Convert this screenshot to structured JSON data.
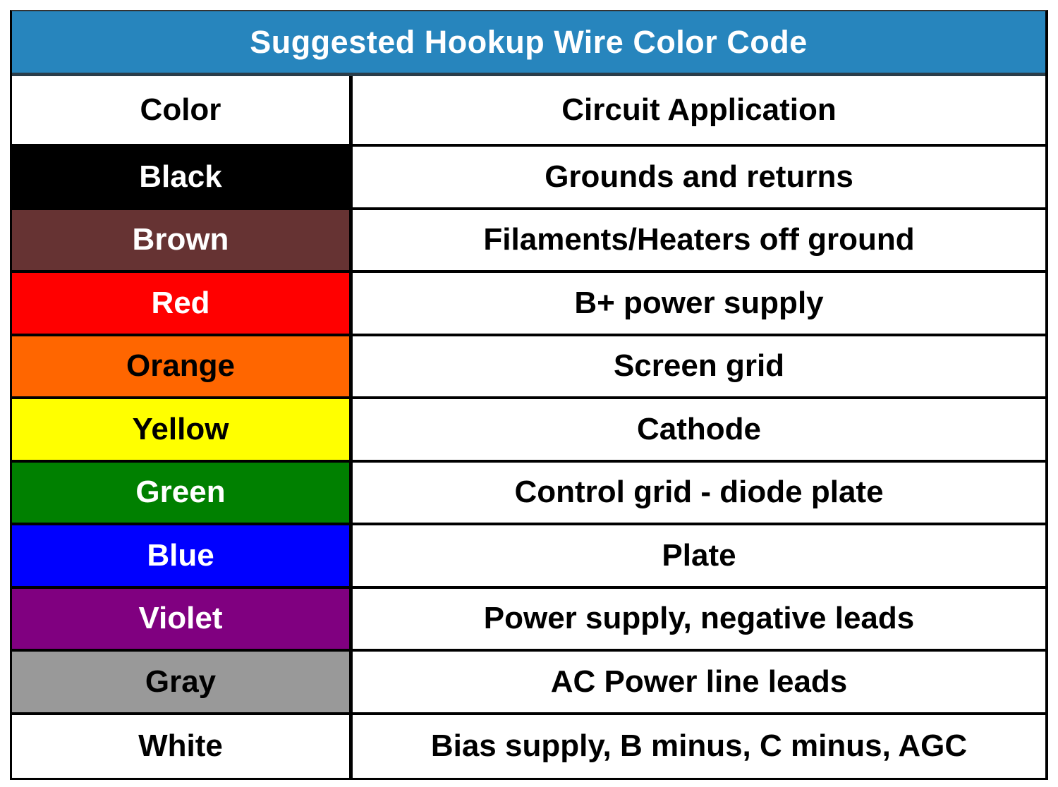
{
  "title": "Suggested Hookup Wire Color Code",
  "header": {
    "color_label": "Color",
    "application_label": "Circuit Application"
  },
  "rows": [
    {
      "color": "Black",
      "application": "Grounds and returns",
      "bg": "#000000",
      "text_color": "#ffffff"
    },
    {
      "color": "Brown",
      "application": "Filaments/Heaters off ground",
      "bg": "#663333",
      "text_color": "#ffffff"
    },
    {
      "color": "Red",
      "application": "B+ power supply",
      "bg": "#ff0000",
      "text_color": "#ffffff"
    },
    {
      "color": "Orange",
      "application": "Screen grid",
      "bg": "#ff6600",
      "text_color": "#000000"
    },
    {
      "color": "Yellow",
      "application": "Cathode",
      "bg": "#ffff00",
      "text_color": "#000000"
    },
    {
      "color": "Green",
      "application": "Control grid - diode plate",
      "bg": "#008000",
      "text_color": "#ffffff"
    },
    {
      "color": "Blue",
      "application": "Plate",
      "bg": "#0000ff",
      "text_color": "#ffffff"
    },
    {
      "color": "Violet",
      "application": "Power supply, negative leads",
      "bg": "#800080",
      "text_color": "#ffffff"
    },
    {
      "color": "Gray",
      "application": "AC Power line leads",
      "bg": "#999999",
      "text_color": "#000000"
    },
    {
      "color": "White",
      "application": "Bias supply, B minus, C minus, AGC",
      "bg": "#ffffff",
      "text_color": "#000000"
    }
  ],
  "colors": {
    "title_bg": "#2785bd",
    "title_text": "#ffffff"
  }
}
